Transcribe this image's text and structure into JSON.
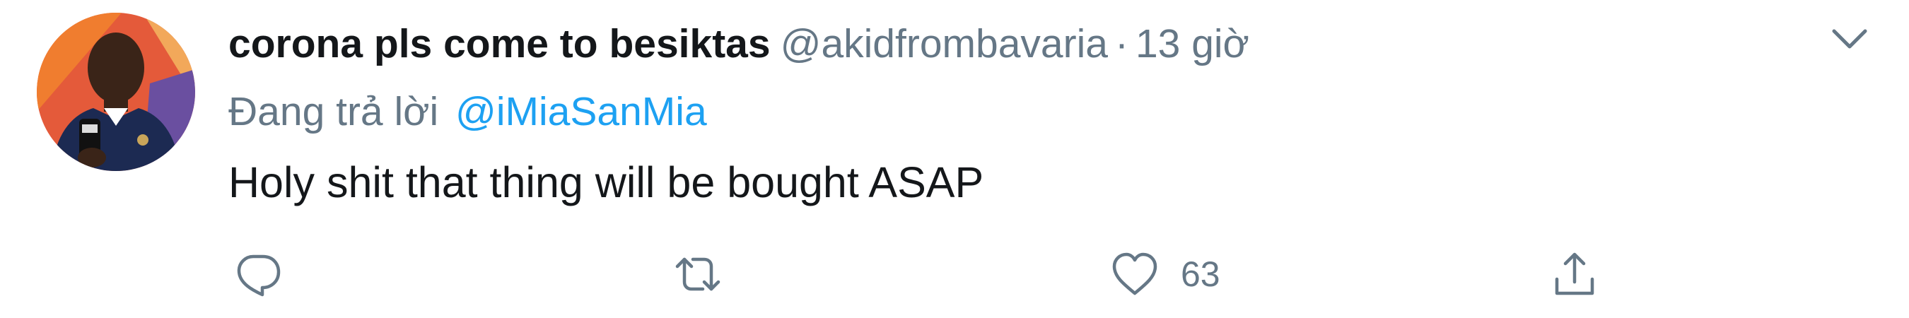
{
  "tweet": {
    "display_name": "corona pls come to besiktas",
    "handle": "@akidfrombavaria",
    "separator": "·",
    "time": "13 giờ",
    "reply_prefix": "Đang trả lời",
    "reply_to": "@iMiaSanMia",
    "text": "Holy shit that thing will be bought ASAP"
  },
  "actions": {
    "reply_count": "",
    "retweet_count": "",
    "like_count": "63"
  },
  "icons": {
    "more": "chevron-down-icon",
    "reply": "speech-bubble-icon",
    "retweet": "retweet-arrows-icon",
    "like": "heart-icon",
    "share": "share-upload-icon"
  },
  "colors": {
    "text": "#14171a",
    "secondary": "#657786",
    "link": "#1da1f2"
  }
}
